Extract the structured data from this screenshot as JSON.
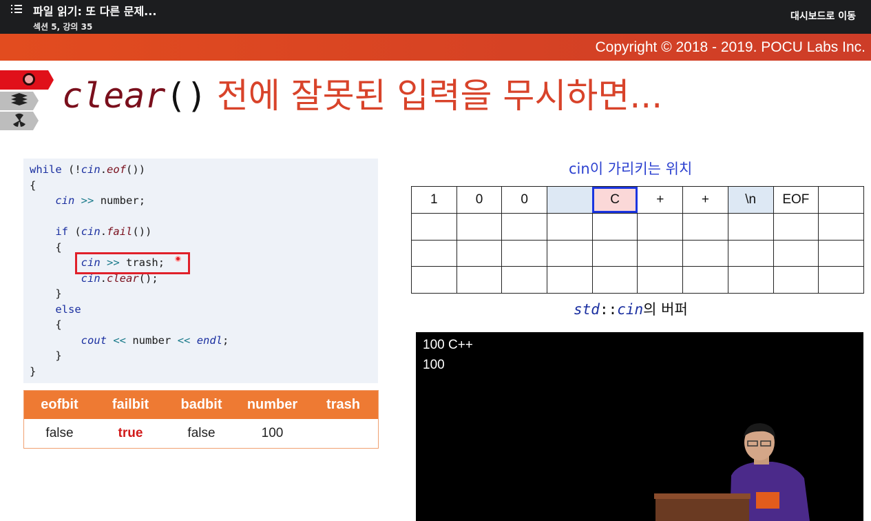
{
  "player": {
    "title": "파일 읽기: 또 다른 문제...",
    "subtitle": "섹션 5, 강의 35",
    "dashboard_link": "대시보드로 이동",
    "menu_icon": "list-icon"
  },
  "slide": {
    "copyright": "Copyright © 2018 - 2019. POCU Labs Inc.",
    "title_fn": "clear",
    "title_paren": "()",
    "title_rest": "전에 잘못된 입력을 무시하면...",
    "tabs": [
      "brain-icon",
      "stack-icon",
      "radiation-icon"
    ],
    "accent_color": "#d8432a"
  },
  "code_lines": [
    "while (!cin.eof())",
    "{",
    "    cin >> number;",
    "",
    "    if (cin.fail())",
    "    {",
    "        cin >> trash;",
    "        cin.clear();",
    "    }",
    "    else",
    "    {",
    "        cout << number << endl;",
    "    }",
    "}"
  ],
  "state_table": {
    "headers": [
      "eofbit",
      "failbit",
      "badbit",
      "number",
      "trash"
    ],
    "values": [
      "false",
      "true",
      "false",
      "100",
      ""
    ]
  },
  "buffer": {
    "caption": "cin이 가리키는 위치",
    "row0": [
      "1",
      "0",
      "0",
      "",
      "C",
      "+",
      "+",
      "\\n",
      "EOF",
      ""
    ],
    "rows": 4,
    "label_std": "std",
    "label_sep": "::",
    "label_cin": "cin",
    "label_ko": "의 버퍼"
  },
  "console": {
    "lines": [
      "100 C++",
      "100"
    ]
  }
}
